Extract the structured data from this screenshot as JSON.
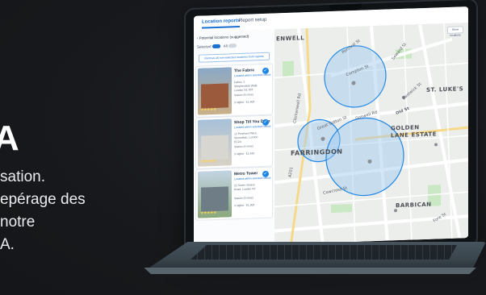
{
  "marketing": {
    "heading_fragment": "A",
    "lines": [
      "sation.",
      "epérage des",
      "notre",
      "A."
    ]
  },
  "app": {
    "tabs": [
      {
        "label": "Location reports",
        "active": true
      },
      {
        "label": "Report setup",
        "active": false
      }
    ],
    "panel": {
      "back_label": "Potential locations (suggested)",
      "toggle_on_label": "Selected",
      "toggle_off_label": "All",
      "cta_label": "Remove all non-selected locations from reports"
    },
    "cards": [
      {
        "title": "The Fabric",
        "link": "Located within selected radius",
        "addr": "Fabric, 1 Shepherdess Walk, London N1 7BT",
        "meta": "Station (6 mins)",
        "meta2": "3 nights · £1,400",
        "rating": "★★★★★"
      },
      {
        "title": "Shop Till You Drop",
        "link": "Located within selected radius",
        "addr": "12 Pershore Place, Shoreditch, London EC2A",
        "meta": "Station (4 mins)",
        "meta2": "3 nights · £1,420",
        "rating": "★★★★★"
      },
      {
        "title": "Metro Tower",
        "link": "Located within selected radius",
        "addr": "22 Seven Sisters Road, London N7",
        "meta": "Station (3 mins)",
        "meta2": "4 nights · £1,300",
        "rating": "★★★★★"
      }
    ],
    "map": {
      "zoom_label": "Show locations",
      "areas": [
        "ENWELL",
        "ST. LUKE'S",
        "GOLDEN",
        "LANE ESTATE",
        "FARRINGDON",
        "BARBICAN"
      ],
      "streets": [
        "Percival St",
        "Compton St",
        "Goswell Rd",
        "Old St",
        "Bastwick St",
        "Seward St",
        "Cowcross St",
        "Great Sutton St",
        "A201",
        "Fore St",
        "Clerkenwell Rd"
      ]
    },
    "colors": {
      "accent": "#1a6fd1",
      "radius_fill": "#9cc7ef",
      "radius_stroke": "#1e86e8",
      "park": "#c9e8c3"
    }
  }
}
